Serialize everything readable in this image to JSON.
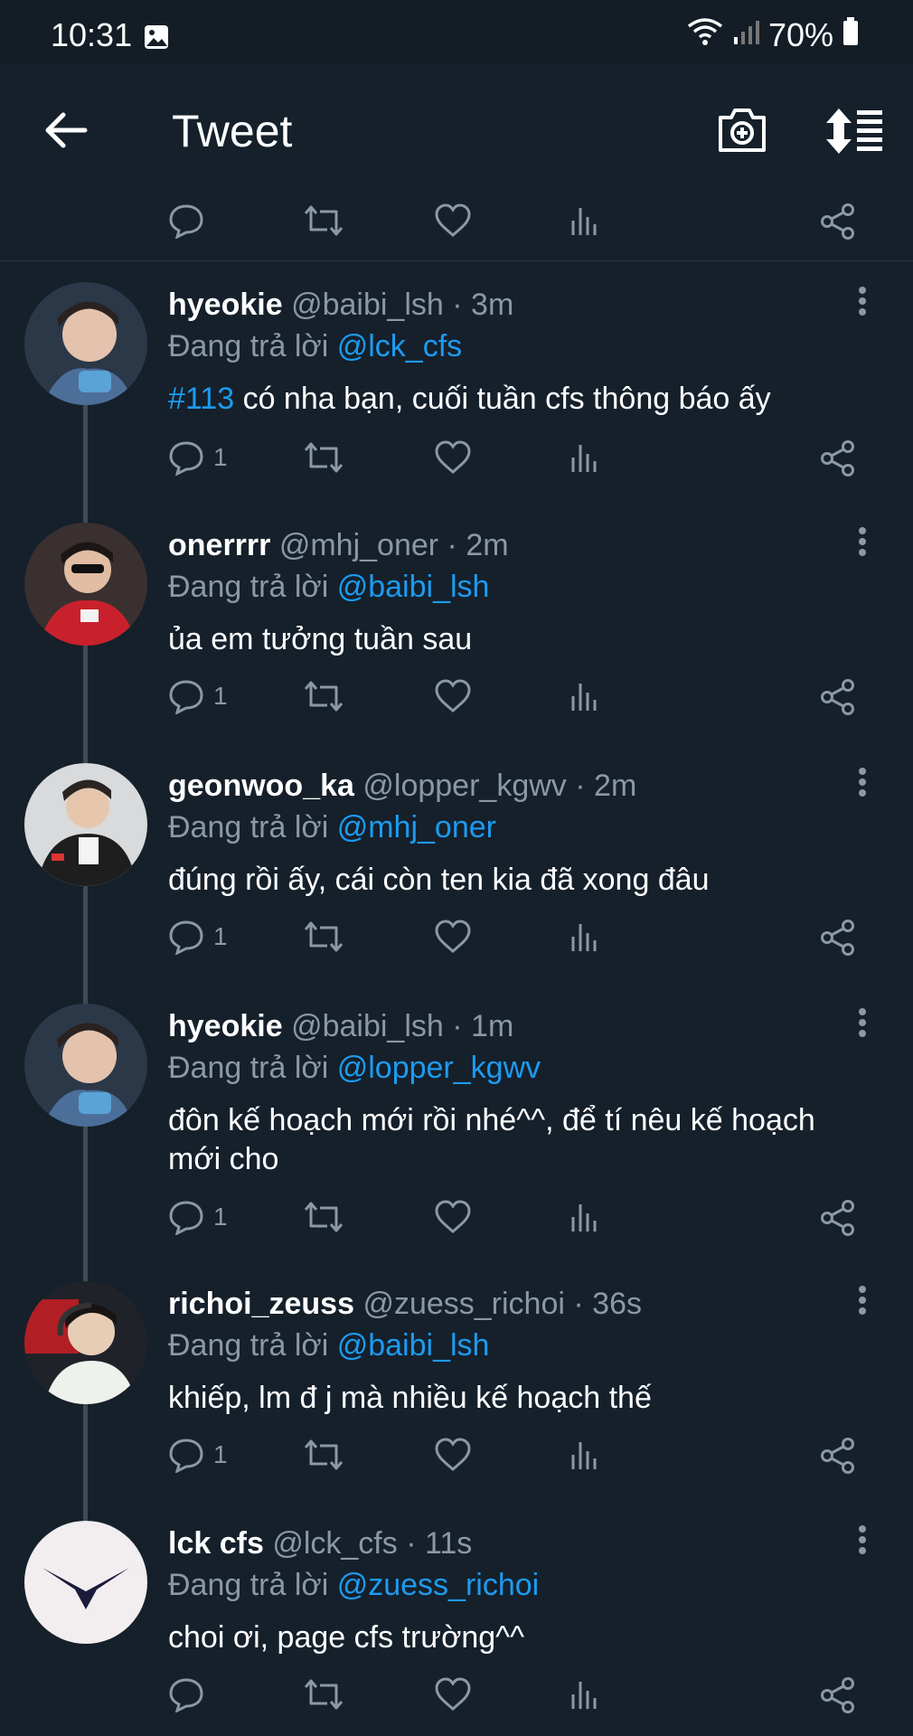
{
  "status_bar": {
    "time": "10:31",
    "battery": "70%"
  },
  "header": {
    "title": "Tweet"
  },
  "reply_prefix": "Đang trả lời",
  "tweets": [
    {
      "name": "hyeokie",
      "handle": "@baibi_lsh",
      "time": "3m",
      "reply_to": "@lck_cfs",
      "hashtag": "#113",
      "text": "có nha bạn, cuối tuần cfs thông báo ấy",
      "replies": "1"
    },
    {
      "name": "onerrrr",
      "handle": "@mhj_oner",
      "time": "2m",
      "reply_to": "@baibi_lsh",
      "hashtag": "",
      "text": "ủa em tưởng tuần sau",
      "replies": "1"
    },
    {
      "name": "geonwoo_ka",
      "handle": "@lopper_kgwv",
      "time": "2m",
      "reply_to": "@mhj_oner",
      "hashtag": "",
      "text": "đúng rồi ấy, cái còn ten kia đã xong đâu",
      "replies": "1"
    },
    {
      "name": "hyeokie",
      "handle": "@baibi_lsh",
      "time": "1m",
      "reply_to": "@lopper_kgwv",
      "hashtag": "",
      "text": "đôn kế hoạch mới rồi nhé^^, để tí nêu kế hoạch mới cho",
      "replies": "1"
    },
    {
      "name": "richoi_zeuss",
      "handle": "@zuess_richoi",
      "time": "36s",
      "reply_to": "@baibi_lsh",
      "hashtag": "",
      "text": "khiếp, lm đ j mà nhiều kế hoạch thế",
      "replies": "1"
    },
    {
      "name": "lck cfs",
      "handle": "@lck_cfs",
      "time": "11s",
      "reply_to": "@zuess_richoi",
      "hashtag": "",
      "text": "choi ơi, page cfs trường^^",
      "replies": ""
    }
  ]
}
